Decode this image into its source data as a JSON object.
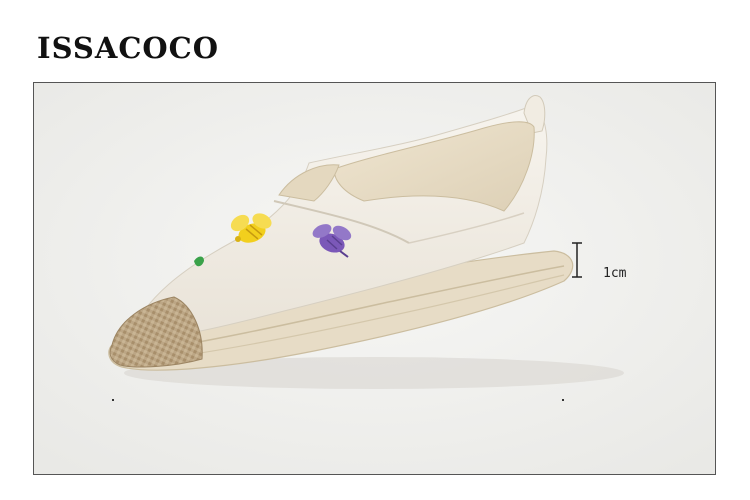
{
  "brand": {
    "name": "ISSACOCO"
  },
  "product": {
    "measurement_label": "1cm"
  },
  "colors": {
    "frame_border": "#555555",
    "canvas_bg": "#f4f4f2",
    "canvas_edge": "#e6e6e3",
    "upper": "#f3efe6",
    "upper_shadow": "#dcd6c9",
    "lining": "#e8dcc4",
    "sole": "#e7dcc6",
    "sole_lines": "#cbbd9f",
    "toe_jute": "#b9a281",
    "toe_jute_dark": "#9c8563",
    "bee_yellow": "#f2cf1d",
    "bee_purple": "#7b58b8",
    "leaf_green": "#3aa24a"
  },
  "icons": {
    "bee_left": "yellow-bee-embroidery-icon",
    "bee_right": "purple-bee-embroidery-icon",
    "height_marker": "height-measure-icon"
  }
}
